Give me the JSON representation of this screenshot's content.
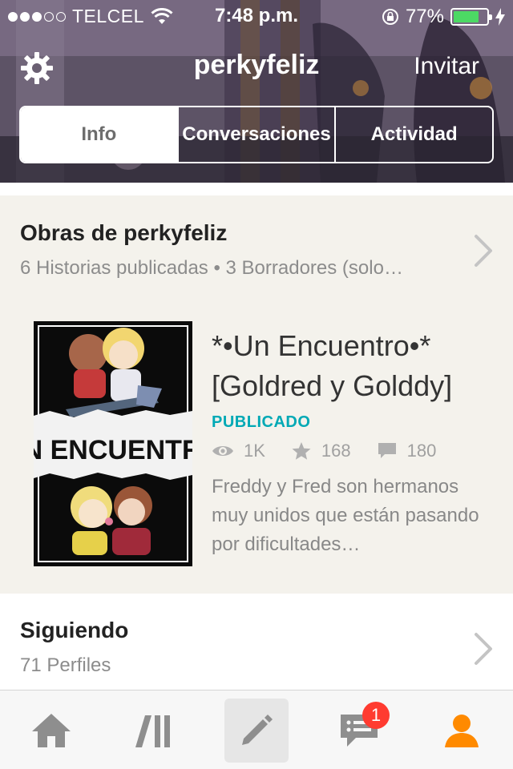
{
  "status_bar": {
    "carrier": "TELCEL",
    "time": "7:48 p.m.",
    "battery_percent": "77%",
    "battery_level": 0.77,
    "signal_bars_filled": 3,
    "signal_bars_total": 5
  },
  "header": {
    "username": "perkyfeliz",
    "invite_label": "Invitar",
    "settings_icon": "gear-icon"
  },
  "tabs": [
    {
      "label": "Info",
      "active": true
    },
    {
      "label": "Conversaciones",
      "active": false
    },
    {
      "label": "Actividad",
      "active": false
    }
  ],
  "works": {
    "title": "Obras de perkyfeliz",
    "subtitle": "6 Historias publicadas • 3 Borradores (solo…",
    "story": {
      "title": "*•Un Encuentro•* [Goldred y Golddy]",
      "cover_text": "UN ENCUENTRO",
      "status": "PUBLICADO",
      "views": "1K",
      "votes": "168",
      "comments": "180",
      "description": "Freddy y Fred son hermanos muy unidos que están pasando  por dificultades…"
    }
  },
  "following": {
    "title": "Siguiendo",
    "subtitle": "71 Perfiles"
  },
  "tab_bar": {
    "items": [
      "home-icon",
      "library-icon",
      "write-icon",
      "messages-icon",
      "profile-icon"
    ],
    "messages_badge": "1"
  },
  "colors": {
    "accent_teal": "#00a9b5",
    "active_tab_orange": "#ff8a00",
    "badge_red": "#ff3b30",
    "battery_green": "#4cd964",
    "section_bg": "#f4f2ec"
  }
}
